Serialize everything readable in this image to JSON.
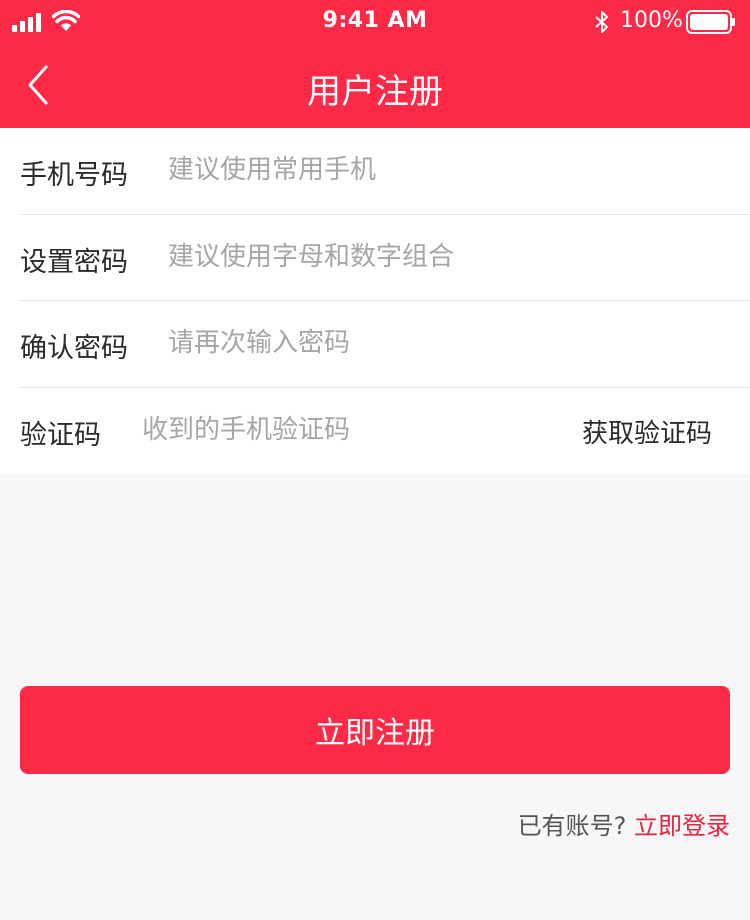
{
  "status_bar": {
    "time": "9:41 AM",
    "battery": "100%"
  },
  "nav": {
    "title": "用户注册"
  },
  "form": {
    "rows": [
      {
        "label": "手机号码",
        "placeholder": "建议使用常用手机"
      },
      {
        "label": "设置密码",
        "placeholder": "建议使用字母和数字组合"
      },
      {
        "label": "确认密码",
        "placeholder": "请再次输入密码"
      },
      {
        "label": "验证码",
        "placeholder": "收到的手机验证码",
        "action": "获取验证码"
      }
    ]
  },
  "register_button": "立即注册",
  "login": {
    "question": "已有账号?",
    "link": "立即登录"
  },
  "colors": {
    "brand": "#fc2a47",
    "link": "#e8233c",
    "background": "#f7f6f9"
  },
  "icons": [
    "signal-icon",
    "wifi-icon",
    "bluetooth-icon",
    "battery-icon",
    "back-arrow-icon"
  ]
}
